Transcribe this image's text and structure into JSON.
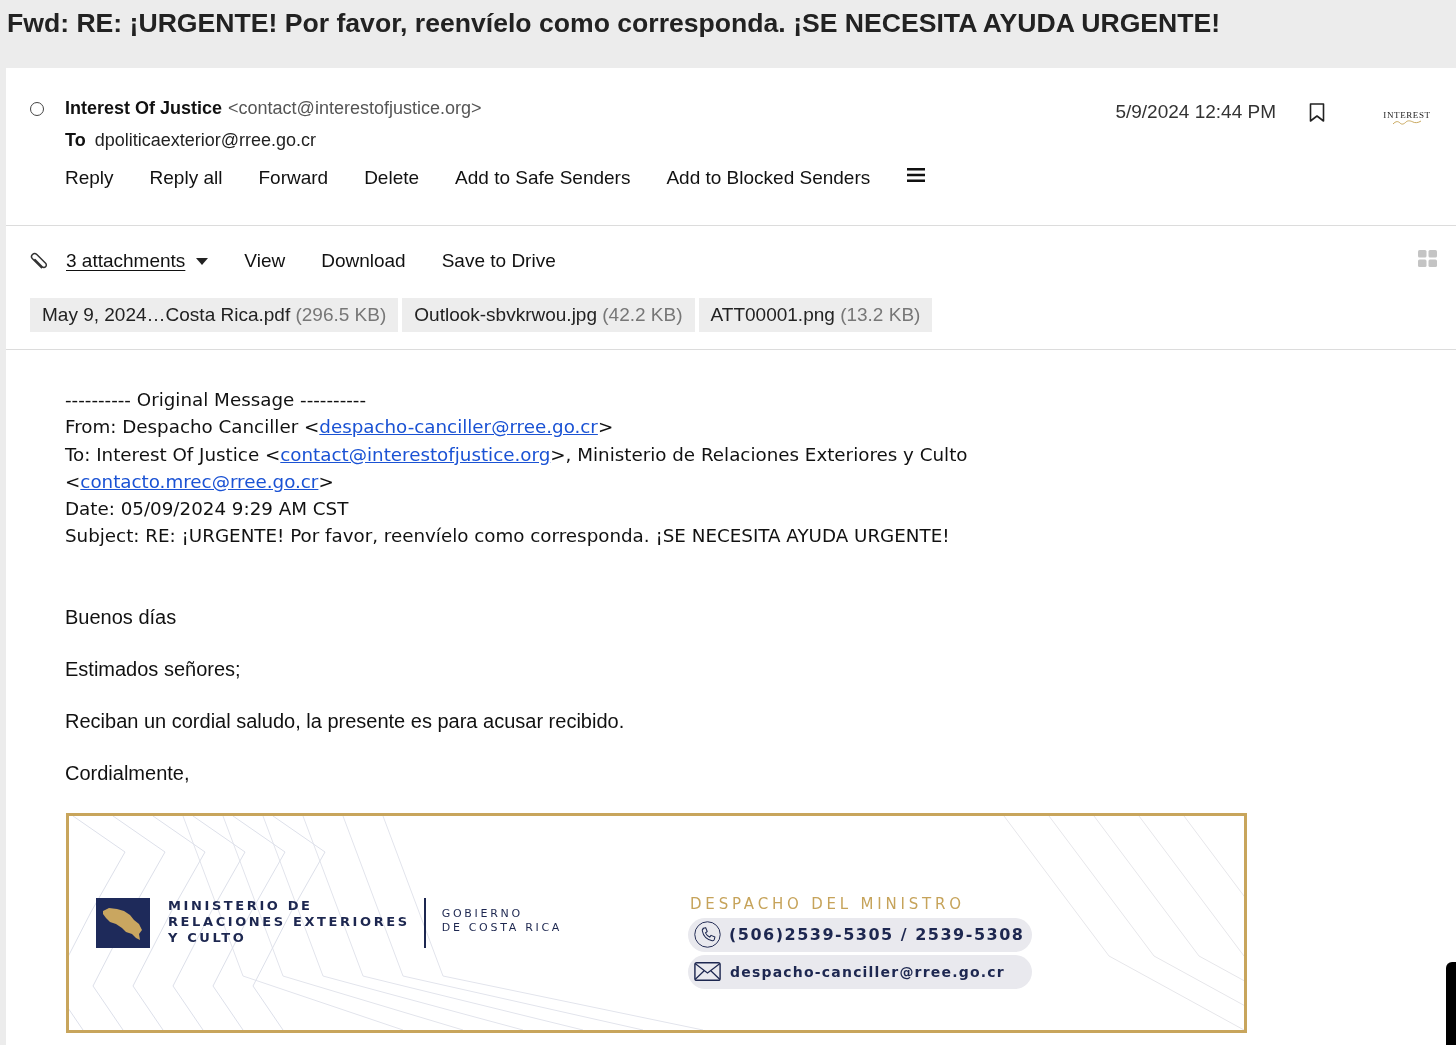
{
  "title": "Fwd: RE: ¡URGENTE! Por favor, reenvíelo como corresponda. ¡SE NECESITA AYUDA URGENTE!",
  "header": {
    "selected": false,
    "sender_name": "Interest Of Justice",
    "sender_email": "<contact@interestofjustice.org>",
    "to_label": "To",
    "recipient": "dpoliticaexterior@rree.go.cr",
    "actions": [
      "Reply",
      "Reply all",
      "Forward",
      "Delete",
      "Add to Safe Senders",
      "Add to Blocked Senders"
    ],
    "date": "5/9/2024 12:44 PM",
    "bookmarked": false,
    "logo_text": "INTEREST"
  },
  "attachments": {
    "summary": "3 attachments",
    "actions": [
      "View",
      "Download",
      "Save to Drive"
    ],
    "files": [
      {
        "name": "May 9, 2024…Costa Rica.pdf",
        "size": "(296.5 KB)"
      },
      {
        "name": "Outlook-sbvkrwou.jpg",
        "size": "(42.2 KB)"
      },
      {
        "name": "ATT00001.png",
        "size": "(13.2 KB)"
      }
    ]
  },
  "original_message": {
    "separator": "---------- Original Message ----------",
    "lines": [
      {
        "parts": [
          {
            "kind": "text",
            "text": "From: Despacho Canciller <"
          },
          {
            "kind": "link",
            "text": "despacho-canciller@rree.go.cr"
          },
          {
            "kind": "text",
            "text": ">"
          }
        ]
      },
      {
        "parts": [
          {
            "kind": "text",
            "text": "To: Interest Of Justice <"
          },
          {
            "kind": "link",
            "text": "contact@interestofjustice.org"
          },
          {
            "kind": "text",
            "text": ">, Ministerio de Relaciones Exteriores y Culto <"
          },
          {
            "kind": "link",
            "text": "contacto.mrec@rree.go.cr"
          },
          {
            "kind": "text",
            "text": ">"
          }
        ]
      },
      {
        "parts": [
          {
            "kind": "text",
            "text": "Date: 05/09/2024 9:29 AM CST"
          }
        ]
      },
      {
        "parts": [
          {
            "kind": "text",
            "text": "Subject: RE: ¡URGENTE! Por favor, reenvíelo como corresponda. ¡SE NECESITA AYUDA URGENTE!"
          }
        ]
      }
    ]
  },
  "body": [
    "Buenos días",
    "Estimados señores;",
    "Reciban un cordial saludo, la presente es para acusar recibido.",
    "Cordialmente,"
  ],
  "signature": {
    "ministry_lines": [
      "MINISTERIO DE",
      "RELACIONES EXTERIORES",
      "Y CULTO"
    ],
    "government_lines": [
      "GOBIERNO",
      "DE COSTA RICA"
    ],
    "office": "DESPACHO DEL MINISTRO",
    "contacts": [
      {
        "kind": "phone",
        "text": "(506)2539-5305 / 2539-5308"
      },
      {
        "kind": "email",
        "text": "despacho-canciller@rree.go.cr"
      }
    ]
  }
}
